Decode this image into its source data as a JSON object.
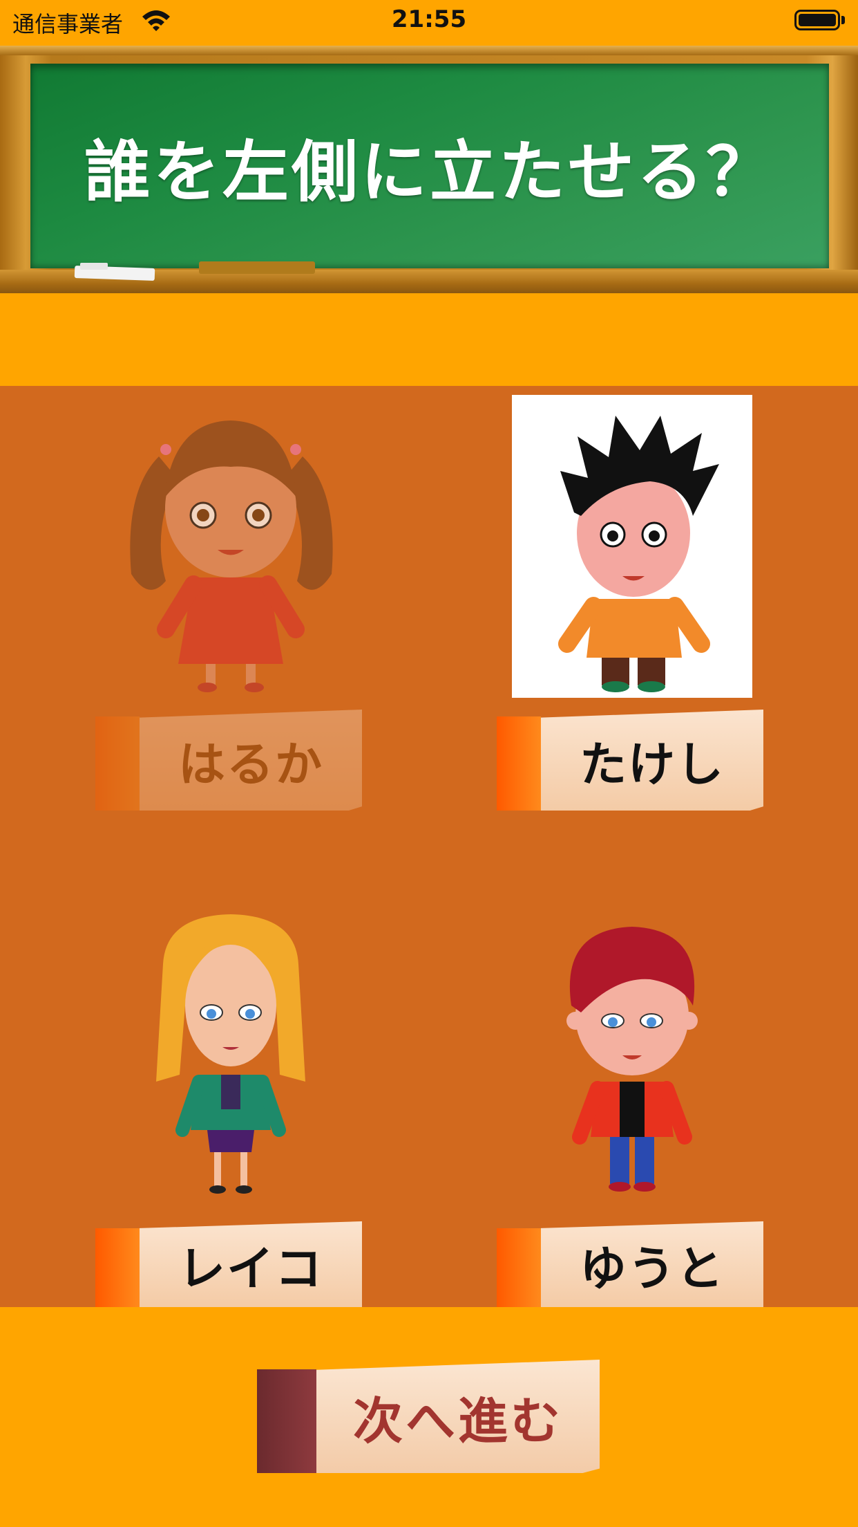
{
  "status_bar": {
    "carrier": "通信事業者",
    "time": "21:55"
  },
  "question": "誰を左側に立たせる？",
  "characters": [
    {
      "name": "はるか",
      "state": "dimmed"
    },
    {
      "name": "たけし",
      "state": "selected"
    },
    {
      "name": "レイコ",
      "state": "normal"
    },
    {
      "name": "ゆうと",
      "state": "normal"
    }
  ],
  "next_button": "次へ進む",
  "colors": {
    "background": "#FFA500",
    "panel": "#D2691E",
    "board": "#1d8a41",
    "tag_tab": "#ff6a0a",
    "next_text": "#a2352f"
  }
}
